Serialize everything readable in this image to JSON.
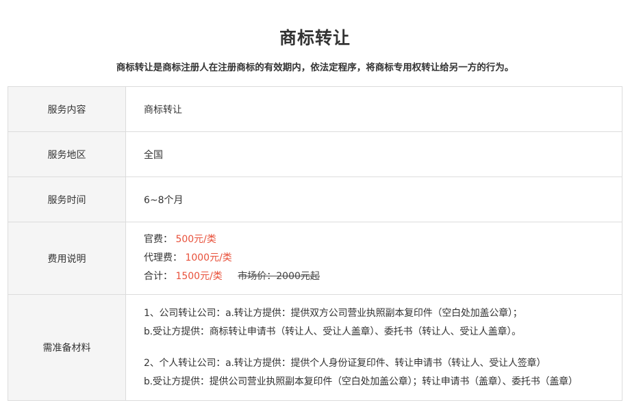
{
  "header": {
    "title": "商标转让",
    "subtitle": "商标转让是商标注册人在注册商标的有效期内，依法定程序，将商标专用权转让给另一方的行为。"
  },
  "table": {
    "service_content": {
      "label": "服务内容",
      "value": "商标转让"
    },
    "service_area": {
      "label": "服务地区",
      "value": "全国"
    },
    "service_time": {
      "label": "服务时间",
      "value": "6~8个月"
    },
    "fees": {
      "label": "费用说明",
      "official_label": "官费：",
      "official_value": "500元/类",
      "agency_label": "代理费：",
      "agency_value": "1000元/类",
      "total_label": "合计：",
      "total_value": "1500元/类",
      "market_price": "市场价：2000元起"
    },
    "materials": {
      "label": "需准备材料",
      "lines": [
        "1、公司转让公司：a.转让方提供：提供双方公司营业执照副本复印件（空白处加盖公章）；",
        "b.受让方提供：商标转让申请书（转让人、受让人盖章）、委托书（转让人、受让人盖章）。",
        "2、个人转让公司：a.转让方提供：提供个人身份证复印件、转让申请书（转让人、受让人签章）",
        "b.受让方提供：提供公司营业执照副本复印件（空白处加盖公章）；转让申请书（盖章）、委托书（盖章）"
      ]
    }
  },
  "colors": {
    "accent_red": "#e8503a",
    "label_bg": "#f5f5f5",
    "border": "#dcdcdc"
  }
}
